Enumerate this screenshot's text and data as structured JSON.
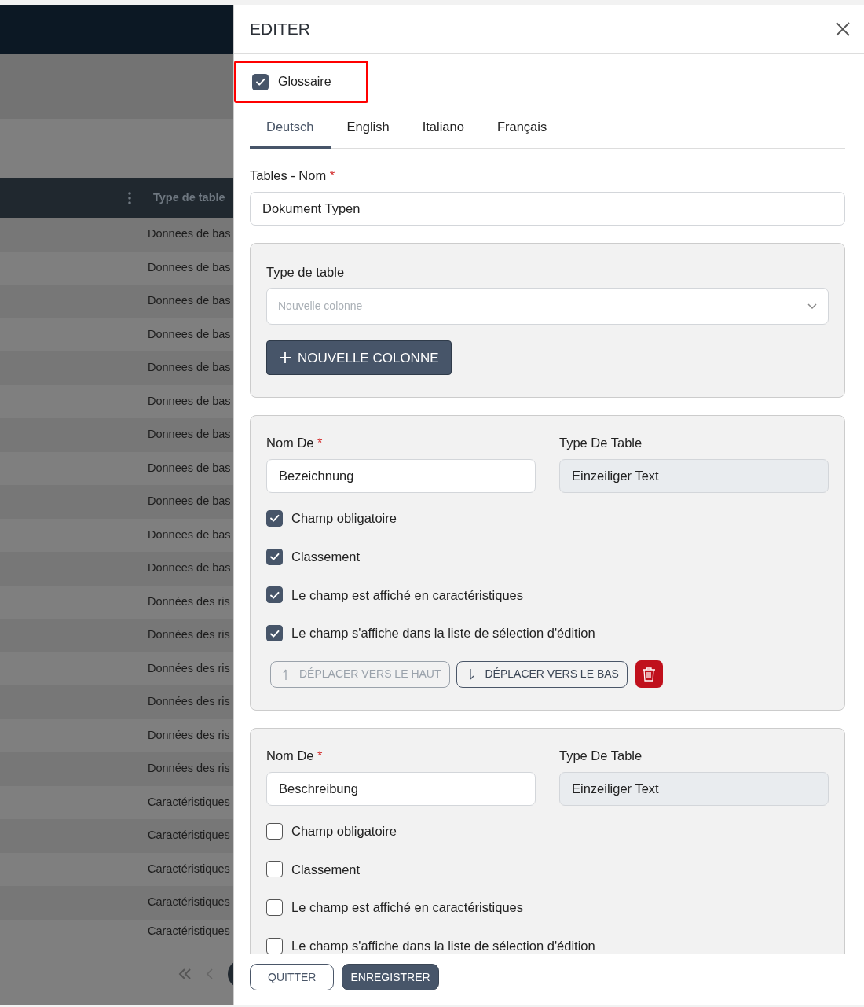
{
  "background": {
    "column_header": "Type de table",
    "rows": [
      "Donnees de bas",
      "Donnees de bas",
      "Donnees de bas",
      "Donnees de bas",
      "Donnees de bas",
      "Donnees de bas",
      "Donnees de bas",
      "Donnees de bas",
      "Donnees de bas",
      "Donnees de bas",
      "Donnees de bas",
      "Données des ris",
      "Données des ris",
      "Données des ris",
      "Données des ris",
      "Données des ris",
      "Données des ris",
      "Caractéristiques",
      "Caractéristiques",
      "Caractéristiques",
      "Caractéristiques",
      "Caractéristiques"
    ]
  },
  "panel": {
    "title": "EDITER",
    "glossary": {
      "label": "Glossaire",
      "checked": true,
      "highlighted": true
    },
    "tabs": [
      {
        "label": "Deutsch",
        "selected": true
      },
      {
        "label": "English",
        "selected": false
      },
      {
        "label": "Italiano",
        "selected": false
      },
      {
        "label": "Français",
        "selected": false
      }
    ],
    "name_field": {
      "label": "Tables - Nom",
      "required_mark": "*",
      "value": "Dokument Typen"
    },
    "new_column": {
      "label": "Type de table",
      "placeholder": "Nouvelle colonne",
      "button": "NOUVELLE COLONNE"
    },
    "columns": [
      {
        "name_label": "Nom De",
        "required_mark": "*",
        "name_value": "Bezeichnung",
        "type_label": "Type De Table",
        "type_value": "Einzeiliger Text",
        "options": [
          {
            "label": "Champ obligatoire",
            "checked": true
          },
          {
            "label": "Classement",
            "checked": true
          },
          {
            "label": "Le champ est affiché en caractéristiques",
            "checked": true
          },
          {
            "label": "Le champ s'affiche dans la liste de sélection d'édition",
            "checked": true
          }
        ],
        "actions": [
          {
            "kind": "up",
            "label": "DÉPLACER VERS LE HAUT",
            "disabled": true
          },
          {
            "kind": "down",
            "label": "DÉPLACER VERS LE BAS",
            "disabled": false
          },
          {
            "kind": "delete"
          }
        ]
      },
      {
        "name_label": "Nom De",
        "required_mark": "*",
        "name_value": "Beschreibung",
        "type_label": "Type De Table",
        "type_value": "Einzeiliger Text",
        "options": [
          {
            "label": "Champ obligatoire",
            "checked": false
          },
          {
            "label": "Classement",
            "checked": false
          },
          {
            "label": "Le champ est affiché en caractéristiques",
            "checked": false
          },
          {
            "label": "Le champ s'affiche dans la liste de sélection d'édition",
            "checked": false
          }
        ]
      }
    ],
    "footer": {
      "cancel": "QUITTER",
      "save": "ENREGISTRER"
    }
  }
}
